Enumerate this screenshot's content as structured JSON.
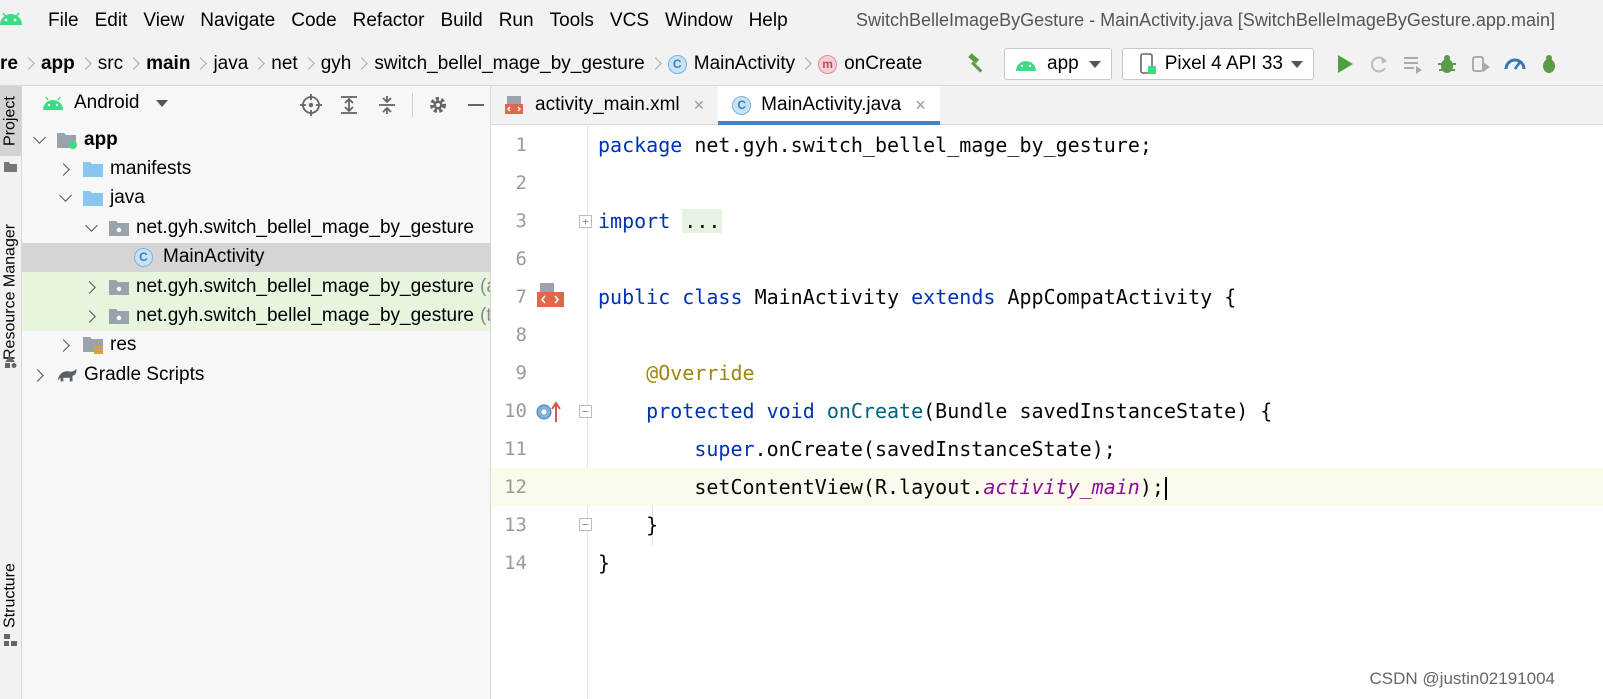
{
  "menubar": {
    "items": [
      "File",
      "Edit",
      "View",
      "Navigate",
      "Code",
      "Refactor",
      "Build",
      "Run",
      "Tools",
      "VCS",
      "Window",
      "Help"
    ],
    "window_title": "SwitchBelleImageByGesture - MainActivity.java [SwitchBelleImageByGesture.app.main]"
  },
  "navbar": {
    "breadcrumbs": [
      "re",
      "app",
      "src",
      "main",
      "java",
      "net",
      "gyh",
      "switch_bellel_mage_by_gesture",
      "MainActivity",
      "onCreate"
    ],
    "class_badge": "C",
    "method_badge": "m",
    "run_config": "app",
    "device": "Pixel 4 API 33",
    "icons": [
      "hammer-icon",
      "run-icon",
      "rerun-icon",
      "coverage-icon",
      "debug-icon",
      "attach-icon",
      "profile-icon",
      "sync-icon"
    ]
  },
  "left_stripe": {
    "project_label": "Project",
    "resource_label": "Resource Manager",
    "structure_label": "Structure"
  },
  "project_panel": {
    "view_label": "Android",
    "tree": [
      {
        "label": "app",
        "bold": true
      },
      {
        "label": "manifests"
      },
      {
        "label": "java"
      },
      {
        "label": "net.gyh.switch_bellel_mage_by_gesture"
      },
      {
        "label": "MainActivity",
        "badge": "C"
      },
      {
        "label": "net.gyh.switch_bellel_mage_by_gesture",
        "suffix": "(a"
      },
      {
        "label": "net.gyh.switch_bellel_mage_by_gesture",
        "suffix": "(te"
      },
      {
        "label": "res"
      },
      {
        "label": "Gradle Scripts"
      }
    ]
  },
  "editor": {
    "tabs": [
      {
        "label": "activity_main.xml",
        "active": false
      },
      {
        "label": "MainActivity.java",
        "active": true
      }
    ],
    "close_glyph": "×",
    "line_numbers": [
      "1",
      "2",
      "3",
      "6",
      "7",
      "8",
      "9",
      "10",
      "11",
      "12",
      "13",
      "14"
    ],
    "code": {
      "l1_kw": "package",
      "l1_rest": " net.gyh.switch_bellel_mage_by_gesture;",
      "l3_kw": "import",
      "l3_fold": "...",
      "l7_kw1": "public",
      "l7_kw2": "class",
      "l7_name": "MainActivity",
      "l7_kw3": "extends",
      "l7_rest": "AppCompatActivity {",
      "l9_ann": "@Override",
      "l10_kw1": "protected",
      "l10_kw2": "void",
      "l10_mth": "onCreate",
      "l10_rest": "(Bundle savedInstanceState) {",
      "l11_kw": "super",
      "l11_rest": ".onCreate(savedInstanceState);",
      "l12_pre": "setContentView(R.layout.",
      "l12_fld": "activity_main",
      "l12_post": ");",
      "l13": "}",
      "l14": "}"
    }
  },
  "watermark": "CSDN @justin02191004",
  "colors": {
    "keyword": "#0033b3",
    "annotation": "#9e880d",
    "method": "#00627a",
    "field": "#871094",
    "active_tab_underline": "#4083c9",
    "selected_row": "#d5d5d5",
    "test_row": "#e7f4de"
  }
}
